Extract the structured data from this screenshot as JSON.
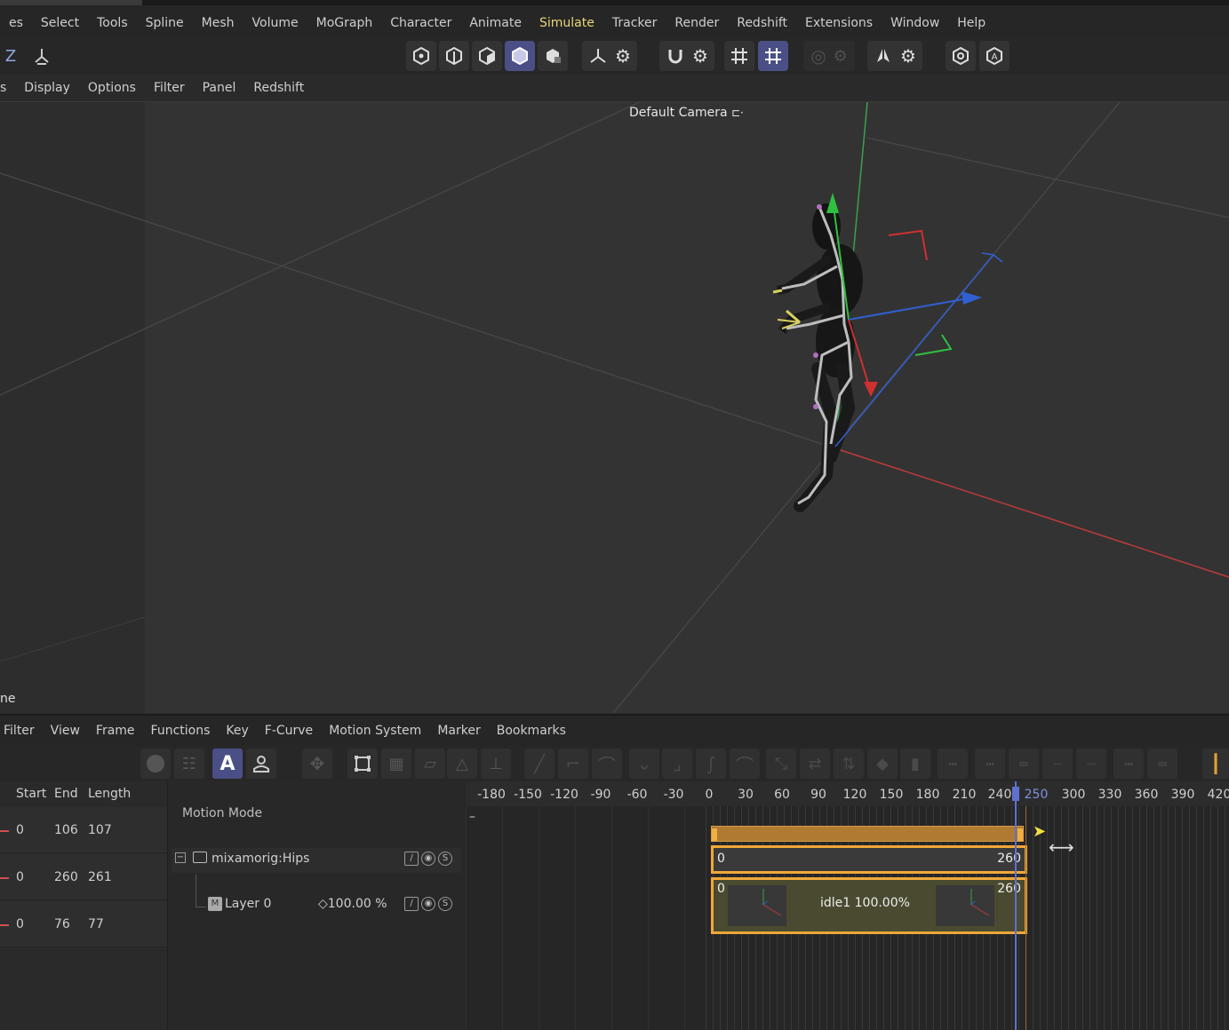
{
  "menubar": {
    "items": [
      "es",
      "Select",
      "Tools",
      "Spline",
      "Mesh",
      "Volume",
      "MoGraph",
      "Character",
      "Animate",
      "Simulate",
      "Tracker",
      "Render",
      "Redshift",
      "Extensions",
      "Window",
      "Help"
    ],
    "active": "Simulate"
  },
  "toolbar": {
    "left_z": "Z",
    "icons": [
      "axis-icon",
      "point-mode-icon",
      "edge-mode-icon",
      "polygon-mode-icon",
      "model-mode-icon",
      "texture-mode-icon",
      "world-axis-icon",
      "axis-settings-icon",
      "snap-icon",
      "snap-settings-icon",
      "grid-icon",
      "workplane-icon",
      "render-region-icon",
      "render-settings-icon",
      "symmetry-icon",
      "symmetry-settings-icon",
      "view-settings-icon",
      "autokey-icon"
    ]
  },
  "viewport_menu": {
    "items": [
      "s",
      "Display",
      "Options",
      "Filter",
      "Panel",
      "Redshift"
    ]
  },
  "viewport": {
    "camera_label": "Default Camera",
    "corner_label": "ne"
  },
  "timeline_menu": {
    "items": [
      "Filter",
      "View",
      "Frame",
      "Functions",
      "Key",
      "F-Curve",
      "Motion System",
      "Marker",
      "Bookmarks"
    ]
  },
  "table": {
    "headers": [
      "Start",
      "End",
      "Length"
    ],
    "rows": [
      {
        "start": "0",
        "end": "106",
        "length": "107"
      },
      {
        "start": "0",
        "end": "260",
        "length": "261"
      },
      {
        "start": "0",
        "end": "76",
        "length": "77"
      }
    ]
  },
  "tree": {
    "mode_label": "Motion Mode",
    "hips_label": "mixamorig:Hips",
    "layer_label": "Layer 0",
    "layer_value": "◇100.00 %"
  },
  "ruler": {
    "ticks": [
      "-180",
      "-150",
      "-120",
      "-90",
      "-60",
      "-30",
      "0",
      "30",
      "60",
      "90",
      "120",
      "150",
      "180",
      "210",
      "240",
      "250",
      "300",
      "330",
      "360",
      "390",
      "420"
    ],
    "current": "250"
  },
  "clips": {
    "bar_start": "0",
    "bar_end": "260",
    "clip_start": "0",
    "clip_end": "260",
    "clip_label": "idle1  100.00%"
  },
  "colors": {
    "accent": "#4a4f86",
    "orange": "#f0a838",
    "active_menu": "#e9d778"
  }
}
